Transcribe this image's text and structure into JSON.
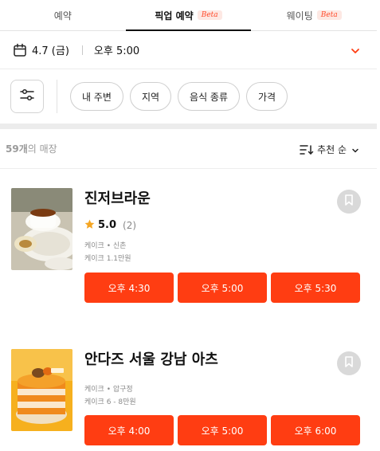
{
  "tabs": [
    {
      "label": "예약",
      "beta": ""
    },
    {
      "label": "픽업 예약",
      "beta": "Beta"
    },
    {
      "label": "웨이팅",
      "beta": "Beta"
    }
  ],
  "datebar": {
    "date": "4.7 (금)",
    "time": "오후 5:00"
  },
  "filters": [
    "내 주변",
    "지역",
    "음식 종류",
    "가격"
  ],
  "list": {
    "count_number": "59개",
    "count_suffix": "의 매장",
    "sort_label": "추천 순"
  },
  "stores": [
    {
      "name": "진저브라운",
      "rating": "5.0",
      "review_count": "(2)",
      "category_area": "케이크 • 신촌",
      "price_info": "케이크 1.1만원",
      "slots": [
        "오후 4:30",
        "오후 5:00",
        "오후 5:30"
      ]
    },
    {
      "name": "안다즈 서울 강남 아츠",
      "category_area": "케이크 • 압구정",
      "price_info": "케이크 6 - 8만원",
      "slots": [
        "오후 4:00",
        "오후 5:00",
        "오후 6:00"
      ]
    }
  ],
  "colors": {
    "accent": "#ff3d12",
    "beta_text": "#ff4a2a",
    "star": "#f5a623"
  },
  "icons": {
    "calendar": "calendar-icon",
    "filter": "sliders-icon",
    "sort": "sort-icon",
    "bookmark": "bookmark-icon",
    "star": "star-icon",
    "chevron": "chevron-down-icon"
  }
}
